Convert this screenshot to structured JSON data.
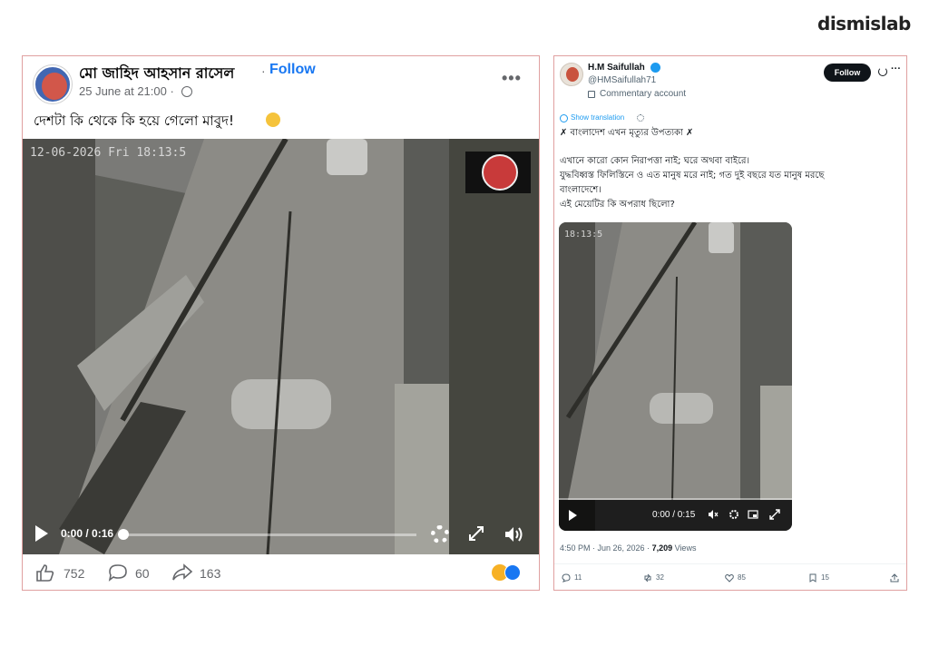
{
  "brand": {
    "name": "dismislab"
  },
  "facebook": {
    "author": "মো জাহিদ আহসান রাসেল",
    "separator": "·",
    "follow": "Follow",
    "time": "25 June at 21:00 ·",
    "more": "•••",
    "text": "দেশটা কি থেকে কি হয়ে গেলো মাবুদ!",
    "video": {
      "timestamp_overlay": "12-06-2026 Fri 18:13:5",
      "timer": "0:00 / 0:16",
      "progress": 0
    },
    "reactions": {
      "likes": "752",
      "comments": "60",
      "shares": "163"
    },
    "icons": {
      "avatar": "profile-photo",
      "globe": "globe-icon",
      "more": "more-icon",
      "play": "play-icon",
      "settings": "gear-icon",
      "expand": "expand-icon",
      "volume": "volume-icon",
      "like": "thumbs-up-icon",
      "comment": "comment-icon",
      "share": "share-icon"
    }
  },
  "x_post": {
    "name": "H.M Saifullah",
    "handle": "@HMSaifullah71",
    "commentary": "Commentary account",
    "follow": "Follow",
    "more": "···",
    "translate": "Show translation",
    "lines": [
      "✗ বাংলাদেশ এখন মৃত্যুর উপত্যকা ✗",
      "এখানে কারো কোন নিরাপত্তা নাই; ঘরে অথবা বাইরে।",
      "যুদ্ধবিধ্বস্ত ফিলিস্তিনে ও এত মানুষ মরে নাই; গত দুই বছরে যত মানুষ মরছে",
      "বাংলাদেশে।",
      "এই মেয়েটির কি অপরাধ ছিলো?"
    ],
    "video": {
      "timestamp_overlay": "18:13:5",
      "timer": "0:00 / 0:15",
      "progress": 0
    },
    "meta": {
      "time": "4:50 PM · Jun 26, 2026 · ",
      "views": "7,209",
      "views_label": " Views"
    },
    "actions": {
      "replies": "11",
      "reposts": "32",
      "likes": "85",
      "bookmarks": "15"
    },
    "accent": "#1d9bf0"
  }
}
